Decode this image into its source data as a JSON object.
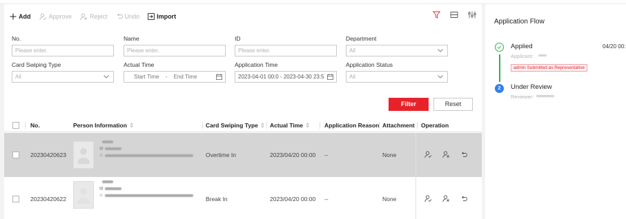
{
  "toolbar": {
    "add": "Add",
    "approve": "Approve",
    "reject": "Reject",
    "undo": "Undo",
    "import": "Import"
  },
  "filters": {
    "no_label": "No.",
    "no_placeholder": "Please enter.",
    "name_label": "Name",
    "name_placeholder": "Please enter.",
    "id_label": "ID",
    "id_placeholder": "Please enter.",
    "department_label": "Department",
    "department_value": "All",
    "card_swiping_type_label": "Card Swiping Type",
    "card_swiping_type_value": "All",
    "actual_time_label": "Actual Time",
    "actual_time_start": "Start Time",
    "actual_time_sep": "-",
    "actual_time_end": "End Time",
    "application_time_label": "Application Time",
    "application_time_value": "2023-04-01 00:0 - 2023-04-30 23:5",
    "application_status_label": "Application Status",
    "application_status_value": "All",
    "filter_button": "Filter",
    "reset_button": "Reset"
  },
  "table": {
    "columns": [
      "No.",
      "Person Information",
      "Card Swiping Type",
      "Actual Time",
      "Application Reason",
      "Attachment",
      "Operation"
    ],
    "rows": [
      {
        "no": "20230420623",
        "card_swiping_type": "Overtime In",
        "actual_time": "2023/04/20 00:00",
        "application_reason": "--",
        "attachment": "None",
        "selected": true
      },
      {
        "no": "20230420622",
        "card_swiping_type": "Break In",
        "actual_time": "2023/04/20 00:00",
        "application_reason": "--",
        "attachment": "None",
        "selected": false
      }
    ]
  },
  "application_flow": {
    "title": "Application Flow",
    "steps": [
      {
        "number": "",
        "title": "Applied",
        "sub": "Applicant:",
        "time": "04/20 00:",
        "tag": "admin Submitted as Representative"
      },
      {
        "number": "2",
        "title": "Under Review",
        "sub": "Reviewer:"
      }
    ]
  },
  "colors": {
    "accent_red": "#e8222a",
    "step_green": "#2ab34b",
    "step_blue": "#2f80ed",
    "selected_row": "#d5d5d5"
  },
  "icons": [
    "plus-icon",
    "approve-icon",
    "reject-icon",
    "undo-icon",
    "import-icon",
    "funnel-icon",
    "column-settings-icon",
    "customize-icon",
    "chevron-down-icon",
    "calendar-icon",
    "person-icon",
    "sort-icon",
    "check-circle-icon"
  ]
}
